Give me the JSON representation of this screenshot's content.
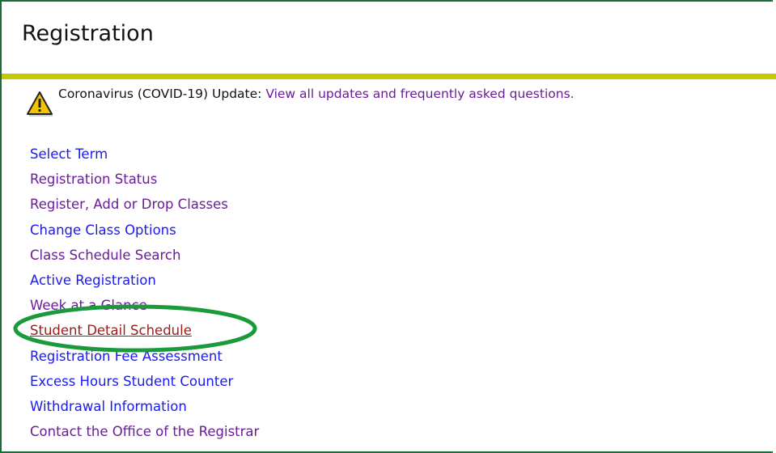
{
  "page": {
    "title": "Registration"
  },
  "notice": {
    "label": "Coronavirus (COVID-19) Update:",
    "link_text": "View all updates and frequently asked questions."
  },
  "menu": {
    "items": [
      {
        "label": "Select Term",
        "color": "#1a1af0"
      },
      {
        "label": "Registration Status",
        "color": "#6b1b9a"
      },
      {
        "label": "Register, Add or Drop Classes",
        "color": "#6b1b9a"
      },
      {
        "label": "Change Class Options",
        "color": "#1a1af0"
      },
      {
        "label": "Class Schedule Search",
        "color": "#6b1b9a"
      },
      {
        "label": "Active Registration",
        "color": "#1a1af0"
      },
      {
        "label": "Week at a Glance",
        "color": "#6b1b9a"
      },
      {
        "label": "Student Detail Schedule",
        "color": "#a11b1b",
        "highlighted": true
      },
      {
        "label": "Registration Fee Assessment",
        "color": "#1a1af0"
      },
      {
        "label": "Excess Hours Student Counter",
        "color": "#1a1af0"
      },
      {
        "label": "Withdrawal Information",
        "color": "#1a1af0"
      },
      {
        "label": "Contact the Office of the Registrar",
        "color": "#6b1b9a"
      }
    ]
  },
  "colors": {
    "frame_border": "#1c6b3a",
    "title_rule": "#c8c800",
    "highlight_ring": "#1a9a3a"
  },
  "icons": {
    "notice": "warning-triangle-icon"
  }
}
